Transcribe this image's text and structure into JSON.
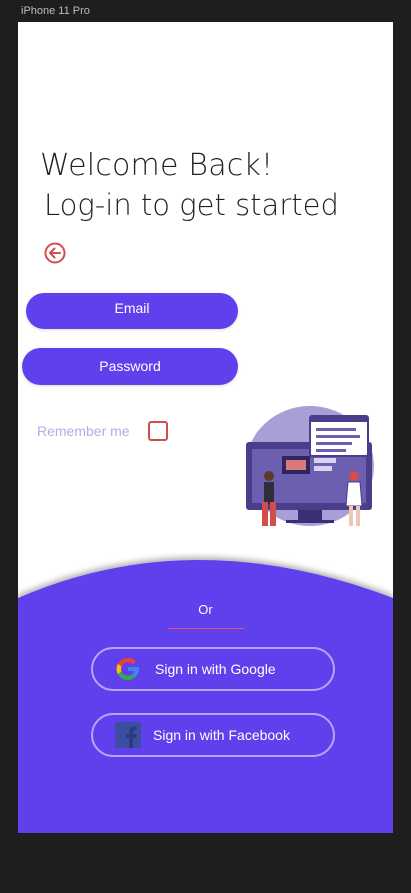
{
  "device": {
    "label": "iPhone 11 Pro"
  },
  "header": {
    "title_line1": "Welcome Back!",
    "title_line2": "Log-in to get started"
  },
  "back": {
    "icon": "arrow-left-circle-icon"
  },
  "form": {
    "email_label": "Email",
    "password_label": "Password",
    "remember_label": "Remember me",
    "remember_checked": false
  },
  "social": {
    "or_text": "Or",
    "google_label": "Sign in with Google",
    "google_icon": "google-icon",
    "facebook_label": "Sign in with Facebook",
    "facebook_icon": "facebook-icon"
  },
  "colors": {
    "primary": "#6040ec",
    "accent": "#d44d4d",
    "background": "#ffffff",
    "frame": "#1e1e1e"
  }
}
